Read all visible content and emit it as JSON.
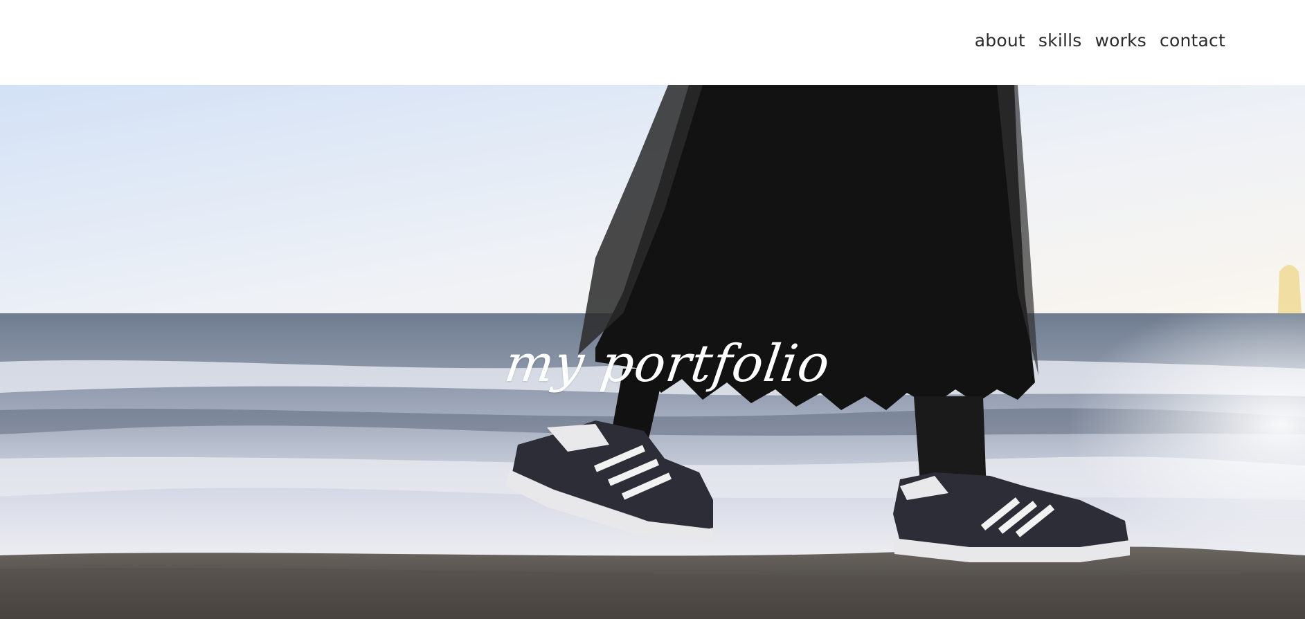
{
  "nav": {
    "items": [
      {
        "label": "about"
      },
      {
        "label": "skills"
      },
      {
        "label": "works"
      },
      {
        "label": "contact"
      }
    ]
  },
  "hero": {
    "title": "my portfolio",
    "image": "beach-walking-photo"
  },
  "colors": {
    "header_bg": "#ffffff",
    "nav_text": "#2b2b2b",
    "title_text": "#ffffff"
  }
}
